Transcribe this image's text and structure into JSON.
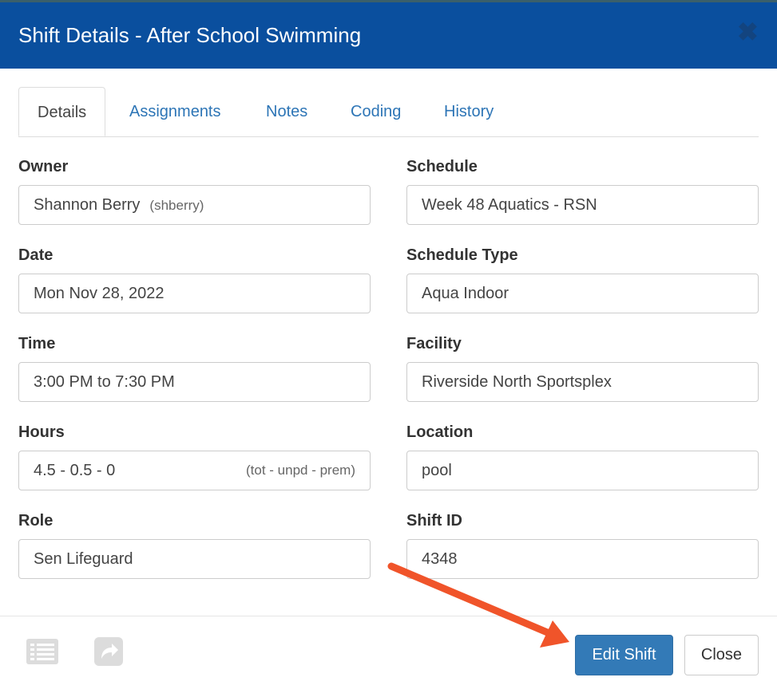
{
  "dialog": {
    "title": "Shift Details - After School Swimming",
    "close_icon": "close-icon"
  },
  "tabs": [
    {
      "label": "Details",
      "active": true
    },
    {
      "label": "Assignments",
      "active": false
    },
    {
      "label": "Notes",
      "active": false
    },
    {
      "label": "Coding",
      "active": false
    },
    {
      "label": "History",
      "active": false
    }
  ],
  "fields": {
    "owner": {
      "label": "Owner",
      "value": "Shannon Berry",
      "sub": "(shberry)"
    },
    "schedule": {
      "label": "Schedule",
      "value": "Week 48 Aquatics - RSN"
    },
    "date": {
      "label": "Date",
      "value": "Mon Nov 28, 2022"
    },
    "schedule_type": {
      "label": "Schedule Type",
      "value": "Aqua Indoor"
    },
    "time": {
      "label": "Time",
      "value": "3:00 PM to 7:30 PM"
    },
    "facility": {
      "label": "Facility",
      "value": "Riverside North Sportsplex"
    },
    "hours": {
      "label": "Hours",
      "value": "4.5 - 0.5 - 0",
      "hint": "(tot - unpd - prem)"
    },
    "location": {
      "label": "Location",
      "value": "pool"
    },
    "role": {
      "label": "Role",
      "value": "Sen Lifeguard"
    },
    "shift_id": {
      "label": "Shift ID",
      "value": "4348"
    }
  },
  "footer": {
    "list_icon": "list-icon",
    "share_icon": "share-forward-icon",
    "edit_label": "Edit Shift",
    "close_label": "Close"
  },
  "colors": {
    "header": "#0a4f9e",
    "link": "#2d75b6",
    "primary_button": "#337ab7",
    "annotation_arrow": "#f0542a"
  }
}
